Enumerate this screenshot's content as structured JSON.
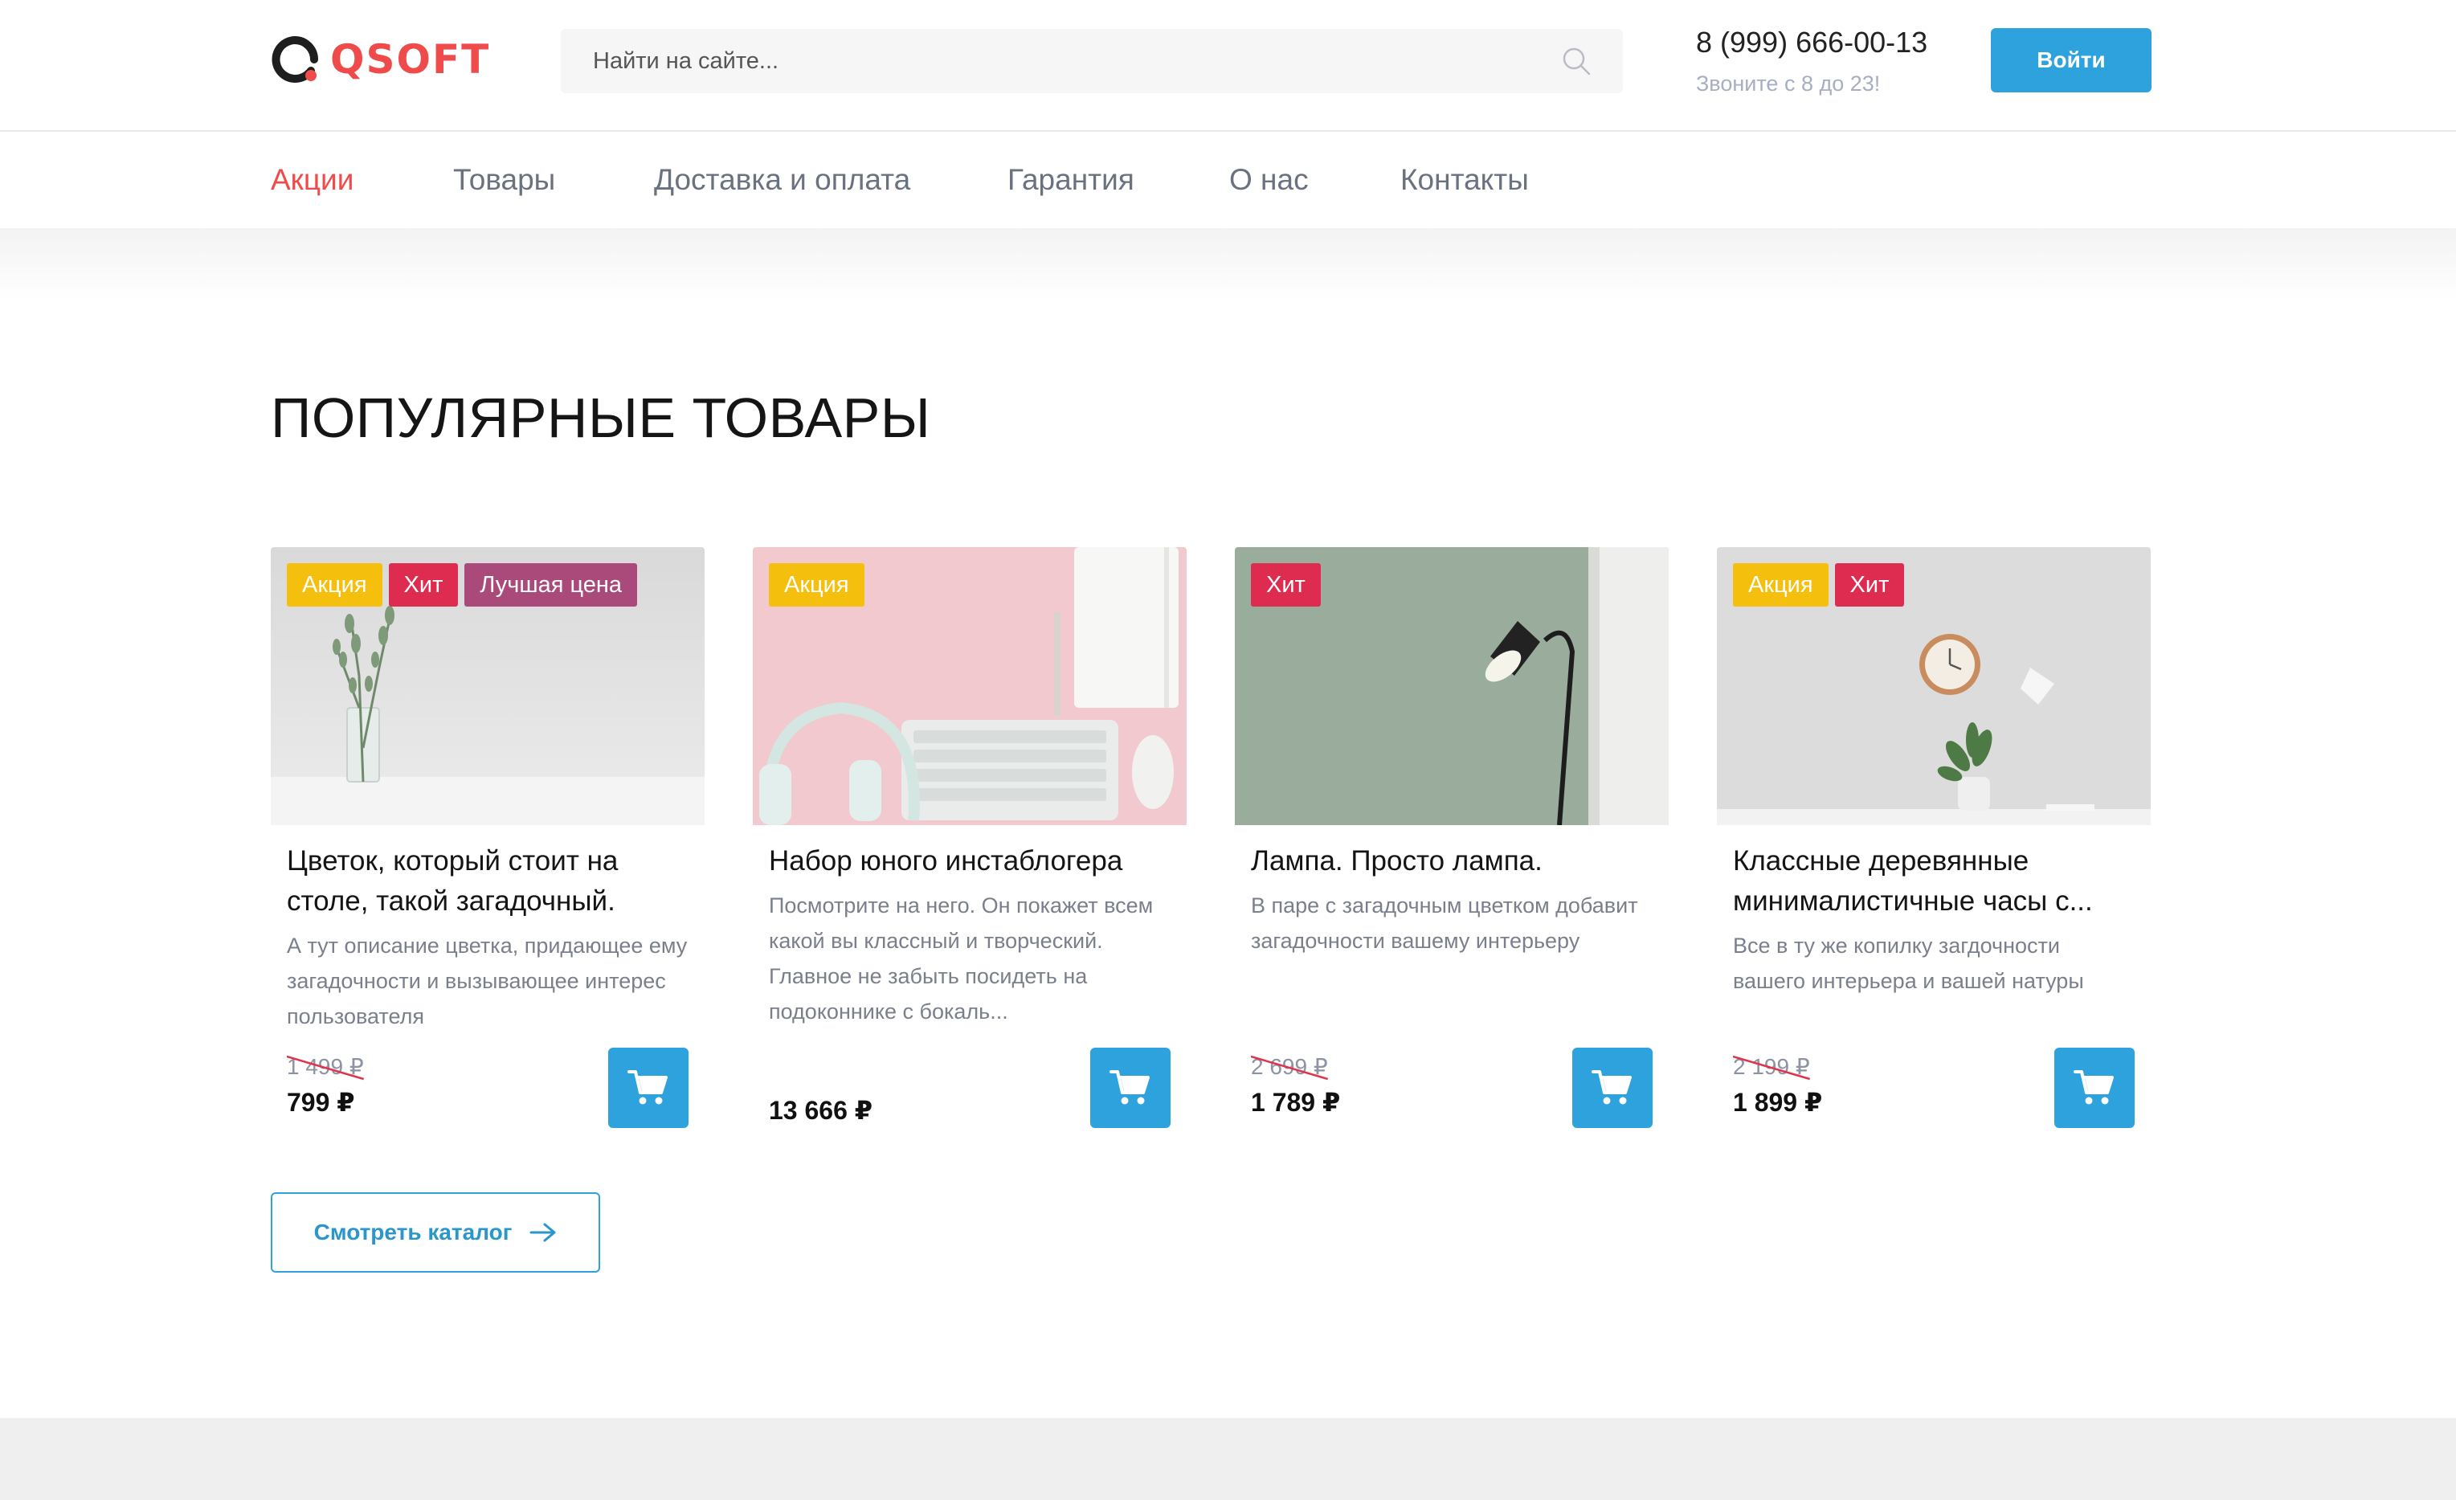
{
  "header": {
    "logo_text": "QSOFT",
    "search": {
      "placeholder": "Найти на сайте..."
    },
    "phone": "8 (999) 666-00-13",
    "phone_hours": "Звоните с 8 до 23!",
    "login_label": "Войти"
  },
  "nav": {
    "items": [
      {
        "label": "Акции",
        "active": true
      },
      {
        "label": "Товары"
      },
      {
        "label": "Доставка и оплата"
      },
      {
        "label": "Гарантия"
      },
      {
        "label": "О нас"
      },
      {
        "label": "Контакты"
      }
    ]
  },
  "main": {
    "section_title": "ПОПУЛЯРНЫЕ ТОВАРЫ",
    "catalog_button": "Смотреть каталог",
    "products": [
      {
        "badges": [
          "Акция",
          "Хит",
          "Лучшая цена"
        ],
        "title": "Цветок, который стоит на столе, такой загадочный.",
        "description": "А тут описание цветка, придающее ему загадочности и вызывающее интерес пользователя",
        "old_price": "1 499 ₽",
        "price": "799 ₽"
      },
      {
        "badges": [
          "Акция"
        ],
        "title": "Набор юного инстаблогера",
        "description": "Посмотрите на него. Он покажет всем какой вы классный и творческий. Главное не забыть посидеть на подоконнике с бокаль...",
        "price": "13 666 ₽"
      },
      {
        "badges": [
          "Хит"
        ],
        "title": "Лампа. Просто лампа.",
        "description": "В паре с загадочным цветком добавит загадочности вашему интерьеру",
        "old_price": "2 699 ₽",
        "price": "1 789 ₽"
      },
      {
        "badges": [
          "Акция",
          "Хит"
        ],
        "title": "Классные деревянные минималистичные часы с...",
        "description": "Все в ту же копилку загдочности вашего интерьера и вашей натуры",
        "old_price": "2 199 ₽",
        "price": "1 899 ₽"
      }
    ]
  },
  "colors": {
    "accent": "#2ea2dc",
    "brand_red": "#f04b4b",
    "badge_sale": "#f5bf0d",
    "badge_hit": "#de2c51",
    "badge_best": "#a94a7b"
  },
  "icons": {
    "search": "search-icon",
    "cart": "cart-icon",
    "arrow": "arrow-right-icon"
  }
}
